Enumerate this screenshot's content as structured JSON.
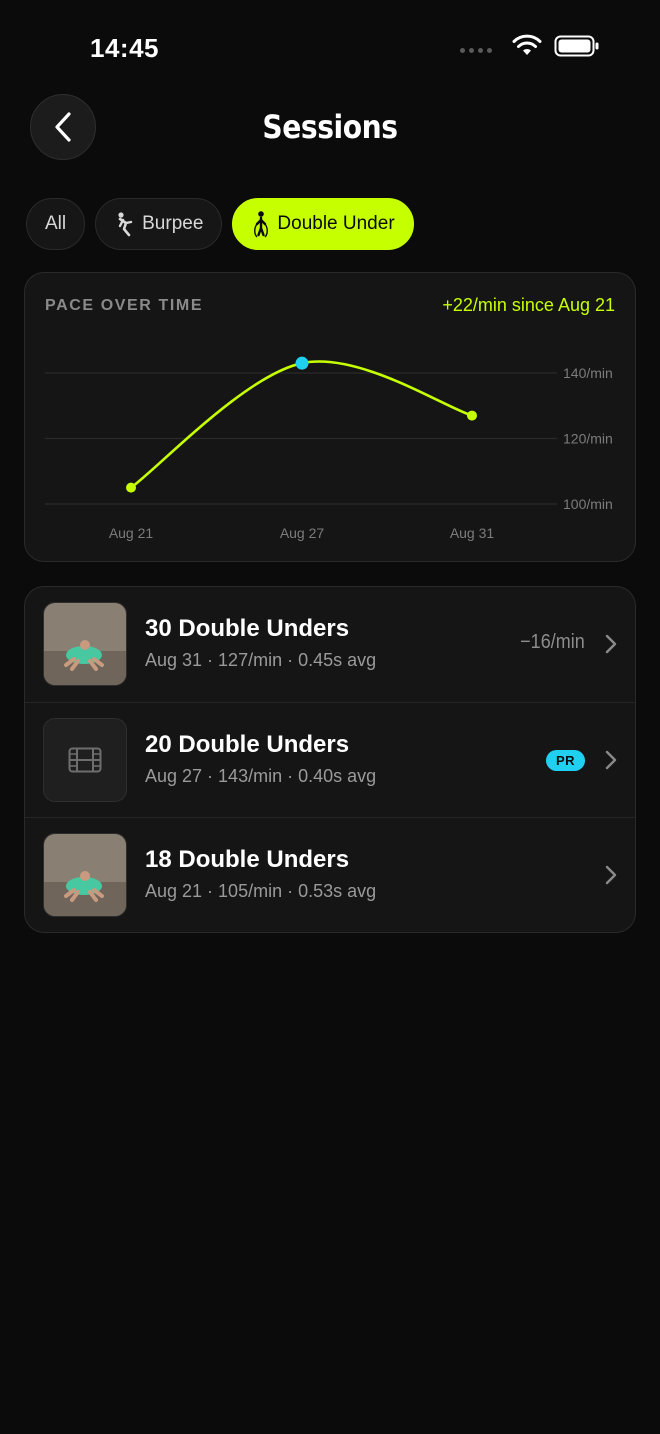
{
  "status": {
    "time": "14:45"
  },
  "header": {
    "title": "Sessions"
  },
  "filters": [
    {
      "label": "All",
      "icon": "none",
      "active": false
    },
    {
      "label": "Burpee",
      "icon": "burpee-icon",
      "active": false
    },
    {
      "label": "Double Under",
      "icon": "jump-rope-icon",
      "active": true
    }
  ],
  "chart": {
    "heading": "PACE OVER TIME",
    "delta": "+22/min since Aug 21"
  },
  "chart_data": {
    "type": "line",
    "x": [
      "Aug 21",
      "Aug 27",
      "Aug 31"
    ],
    "series": [
      {
        "values": [
          105,
          143,
          127
        ]
      }
    ],
    "y_ticks": [
      "140/min",
      "120/min",
      "100/min"
    ],
    "ylim": [
      100,
      140
    ],
    "highlight_index": 1,
    "grid": true,
    "colors": {
      "line": "#c6ff00",
      "highlight": "#1fd0f0"
    }
  },
  "sessions": [
    {
      "title": "30 Double Unders",
      "meta": "Aug 31 · 127/min · 0.45s avg",
      "delta": "−16/min",
      "badge": "",
      "thumb": "photo"
    },
    {
      "title": "20 Double Unders",
      "meta": "Aug 27 · 143/min · 0.40s avg",
      "delta": "",
      "badge": "PR",
      "thumb": "film-icon"
    },
    {
      "title": "18 Double Unders",
      "meta": "Aug 21 · 105/min · 0.53s avg",
      "delta": "",
      "badge": "",
      "thumb": "photo"
    }
  ],
  "colors": {
    "accent": "#c6ff00",
    "pr": "#1fd0f0",
    "background": "#0b0b0b"
  }
}
